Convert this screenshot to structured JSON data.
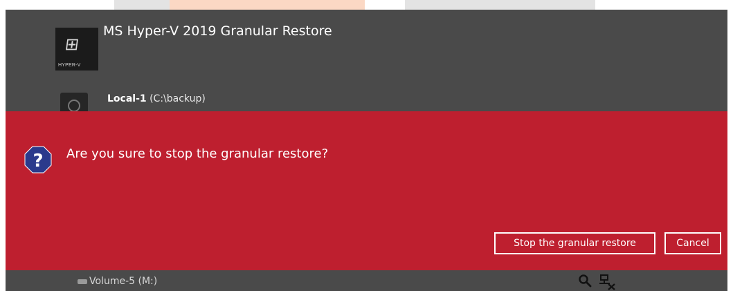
{
  "app": {
    "title": "MS Hyper-V 2019 Granular Restore",
    "icon_caption": "HYPER-V",
    "icon_name": "windows-logo-icon"
  },
  "destination": {
    "name": "Local-1",
    "path": "(C:\\backup)",
    "icon_name": "local-disk-icon"
  },
  "volume": {
    "label": "Volume-5 (M:)",
    "icon_name": "drive-icon"
  },
  "toolbar": {
    "search_icon": "search-icon",
    "network_icon": "network-disconnected-icon"
  },
  "dialog": {
    "message": "Are you sure to stop the granular restore?",
    "icon_name": "question-icon",
    "primary_button": "Stop the granular restore",
    "cancel_button": "Cancel"
  },
  "colors": {
    "window_bg": "#4a4a4a",
    "dialog_bg": "#be1f2f",
    "question_icon_bg": "#2b3a8c",
    "top_strip_gray": "#d9d9d9",
    "top_strip_peach": "#fbd8c4"
  }
}
